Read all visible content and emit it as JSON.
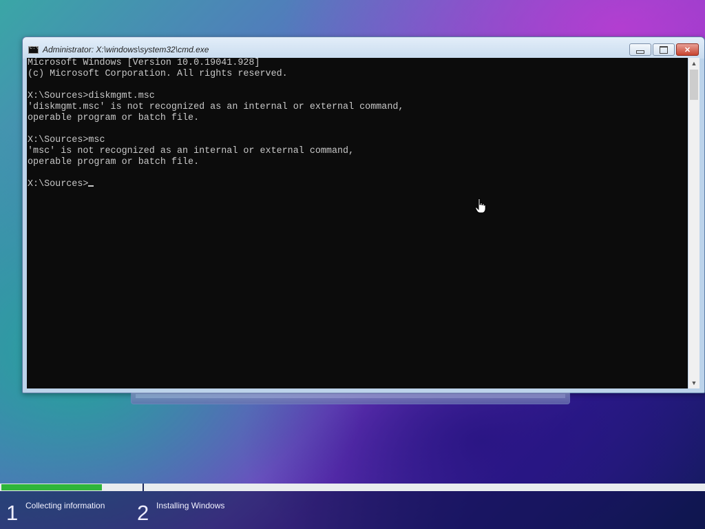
{
  "window": {
    "title": "Administrator: X:\\windows\\system32\\cmd.exe",
    "buttons": {
      "minimize": "minimize",
      "maximize": "maximize",
      "close": "✕"
    }
  },
  "console": {
    "lines": [
      "Microsoft Windows [Version 10.0.19041.928]",
      "(c) Microsoft Corporation. All rights reserved.",
      "",
      "X:\\Sources>diskmgmt.msc",
      "'diskmgmt.msc' is not recognized as an internal or external command,",
      "operable program or batch file.",
      "",
      "X:\\Sources>msc",
      "'msc' is not recognized as an internal or external command,",
      "operable program or batch file.",
      "",
      "X:\\Sources>"
    ]
  },
  "setup_progress": {
    "steps": [
      {
        "number": "1",
        "label": "Collecting information"
      },
      {
        "number": "2",
        "label": "Installing Windows"
      }
    ],
    "step1_fill_fraction": 0.72
  },
  "colors": {
    "console_bg": "#0c0c0c",
    "console_text": "#c8c8c8",
    "progress_green": "#2fb53a"
  },
  "icons": {
    "title": "cmd-icon",
    "pointer": "hand-pointer-icon"
  }
}
